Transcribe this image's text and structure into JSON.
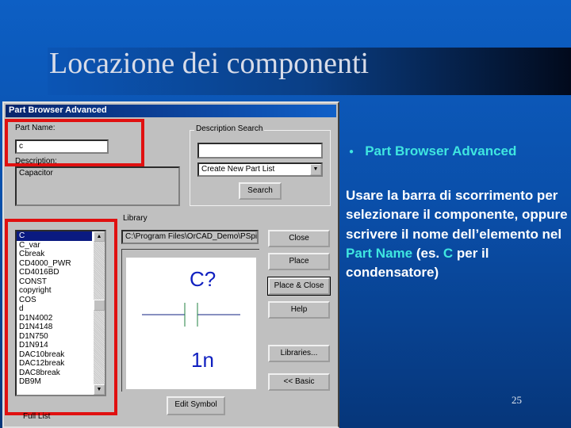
{
  "slide": {
    "title": "Locazione dei componenti",
    "bullet": "Part Browser Advanced",
    "body_pre": "Usare la barra di scorrimento per selezionare il componente, oppure scrivere il nome dell’elemento nel ",
    "body_hl1": "Part Name",
    "body_mid": " (es. ",
    "body_hl2": "C",
    "body_post": " per il condensatore)",
    "page_number": "25",
    "accent": "#3fe6e0",
    "highlight_box_color": "#e01010"
  },
  "dialog": {
    "title": "Part Browser Advanced",
    "part_name_label": "Part Name:",
    "part_name_value": "c",
    "description_label": "Description:",
    "description_value": "Capacitor",
    "desc_search_label": "Description Search",
    "desc_search_value": "",
    "part_list_select": "Create New Part List",
    "search_button": "Search",
    "library_label": "Library",
    "library_path": "C:\\Program Files\\OrCAD_Demo\\PSpi",
    "parts": [
      "C",
      "C_var",
      "Cbreak",
      "CD4000_PWR",
      "CD4016BD",
      "CONST",
      "copyright",
      "COS",
      "d",
      "D1N4002",
      "D1N4148",
      "D1N750",
      "D1N914",
      "DAC10break",
      "DAC12break",
      "DAC8break",
      "DB9M"
    ],
    "selected_part": "C",
    "preview_ref": "C?",
    "preview_value": "1n",
    "buttons": {
      "close": "Close",
      "place": "Place",
      "place_close": "Place & Close",
      "help": "Help",
      "libraries": "Libraries...",
      "basic": "<< Basic",
      "edit_symbol": "Edit Symbol"
    },
    "full_list_label": "Full List"
  }
}
